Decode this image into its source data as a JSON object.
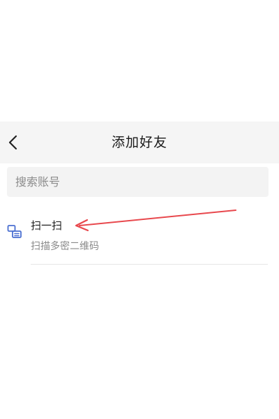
{
  "nav": {
    "title": "添加好友",
    "back_icon": "chevron-left-icon"
  },
  "search": {
    "placeholder": "搜索账号"
  },
  "scan": {
    "icon": "scan-icon",
    "title": "扫一扫",
    "subtitle": "扫描多密二维码"
  },
  "colors": {
    "nav_bg": "#f5f5f5",
    "search_bg": "#f3f3f3",
    "icon_blue": "#4a6fd1",
    "annotation_red": "#e8484d"
  }
}
